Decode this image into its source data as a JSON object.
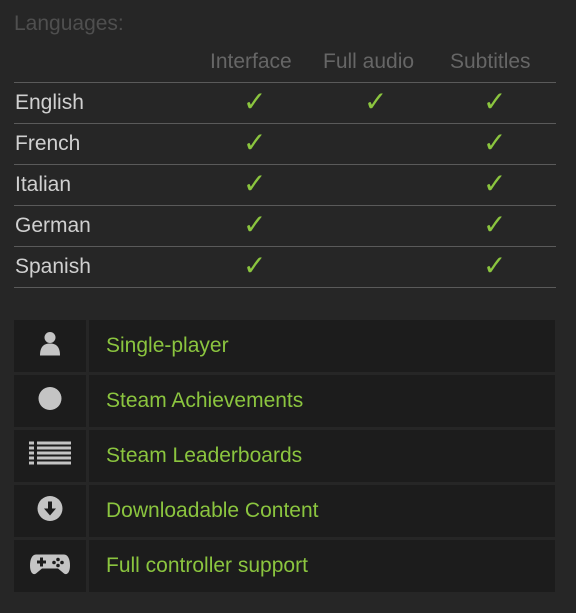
{
  "languages": {
    "title": "Languages:",
    "columns": [
      "Interface",
      "Full audio",
      "Subtitles"
    ],
    "check_color": "#8bc53f",
    "check_glyph": "✓",
    "rows": [
      {
        "name": "English",
        "interface": true,
        "full_audio": true,
        "subtitles": true
      },
      {
        "name": "French",
        "interface": true,
        "full_audio": false,
        "subtitles": true
      },
      {
        "name": "Italian",
        "interface": true,
        "full_audio": false,
        "subtitles": true
      },
      {
        "name": "German",
        "interface": true,
        "full_audio": false,
        "subtitles": true
      },
      {
        "name": "Spanish",
        "interface": true,
        "full_audio": false,
        "subtitles": true
      }
    ]
  },
  "features": [
    {
      "label": "Single-player",
      "icon": "single-player-icon"
    },
    {
      "label": "Steam Achievements",
      "icon": "achievements-icon"
    },
    {
      "label": "Steam Leaderboards",
      "icon": "leaderboards-icon"
    },
    {
      "label": "Downloadable Content",
      "icon": "dlc-icon"
    },
    {
      "label": "Full controller support",
      "icon": "controller-icon"
    }
  ],
  "colors": {
    "accent": "#8bc53f",
    "background": "#262626",
    "panel": "#1c1c1c",
    "icon": "#c4c4c4"
  }
}
